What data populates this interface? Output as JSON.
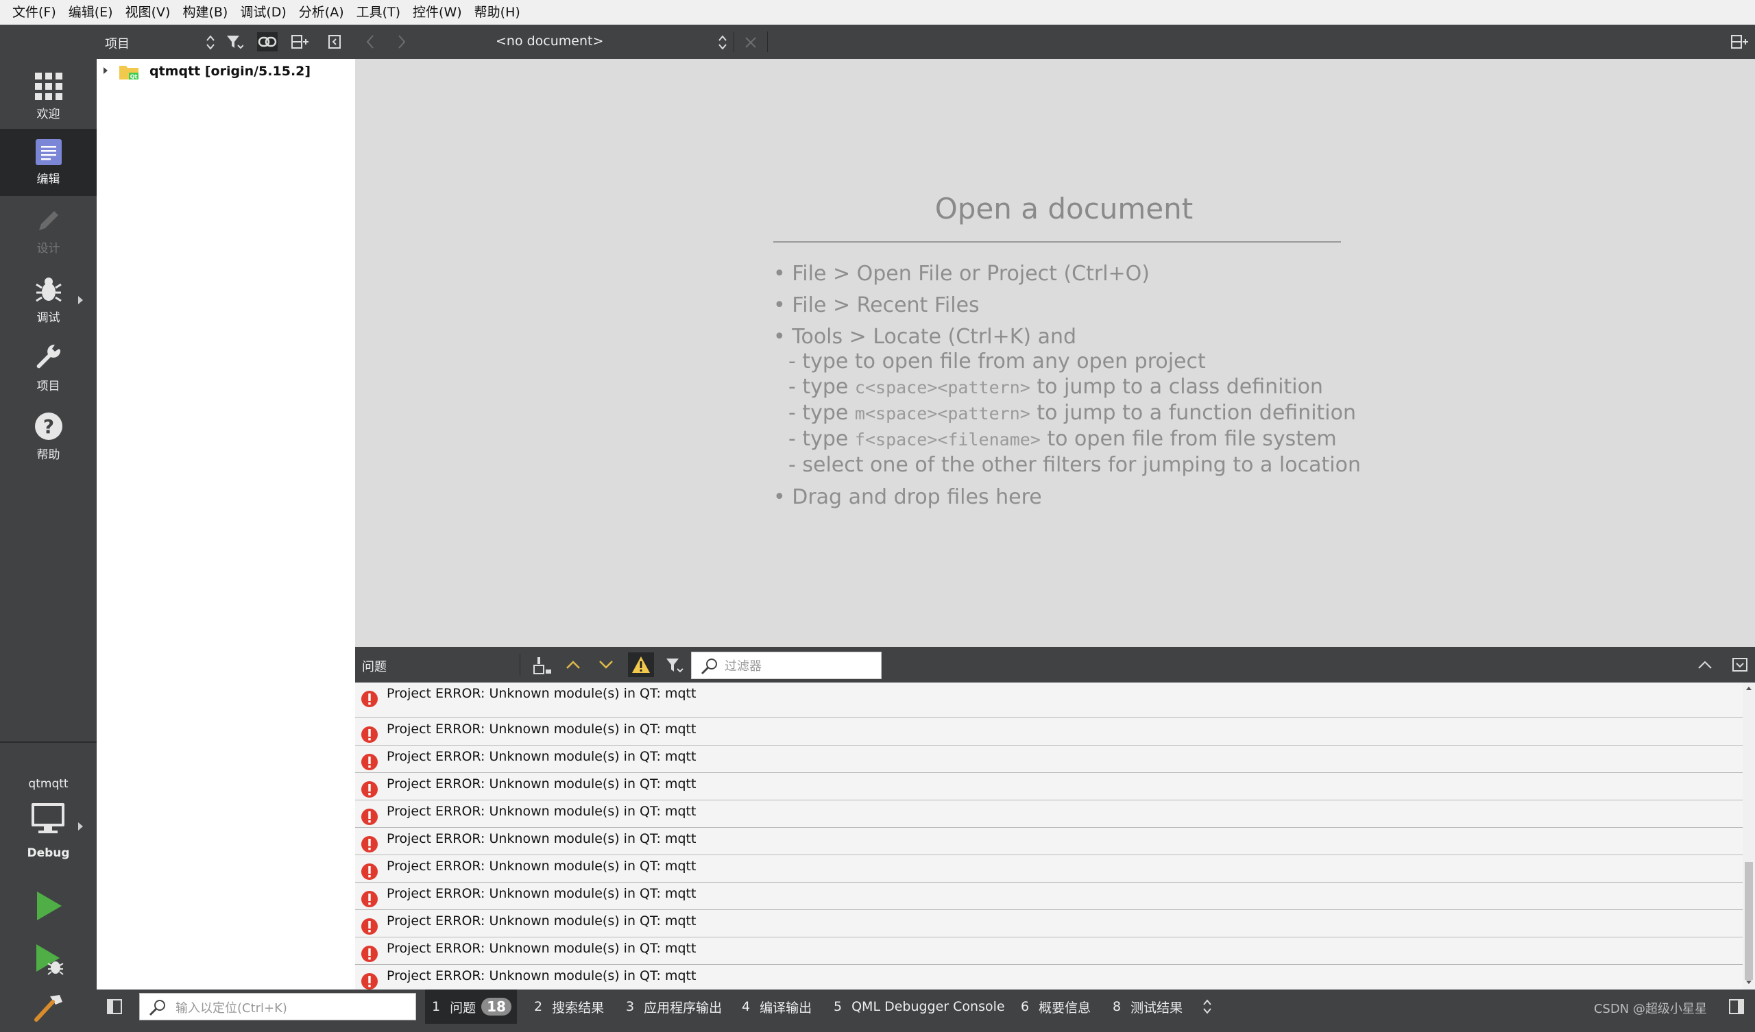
{
  "menu": [
    "文件(F)",
    "编辑(E)",
    "视图(V)",
    "构建(B)",
    "调试(D)",
    "分析(A)",
    "工具(T)",
    "控件(W)",
    "帮助(H)"
  ],
  "modes": [
    {
      "label": "欢迎",
      "icon": "grid-icon",
      "state": "normal"
    },
    {
      "label": "编辑",
      "icon": "edit-document-icon",
      "state": "active"
    },
    {
      "label": "设计",
      "icon": "pencil-icon",
      "state": "disabled"
    },
    {
      "label": "调试",
      "icon": "bug-icon",
      "state": "normal"
    },
    {
      "label": "项目",
      "icon": "wrench-icon",
      "state": "normal"
    },
    {
      "label": "帮助",
      "icon": "help-icon",
      "state": "normal"
    }
  ],
  "kit": {
    "project": "qtmqtt",
    "build": "Debug"
  },
  "project_panel": {
    "title": "项目",
    "tree": [
      {
        "label": "qtmqtt [origin/5.15.2]",
        "icon": "qt-folder-icon",
        "expanded": false
      }
    ]
  },
  "editor_toolbar": {
    "document": "<no document>"
  },
  "editor": {
    "title": "Open a document",
    "lines": [
      "• File > Open File or Project (Ctrl+O)",
      "• File > Recent Files",
      "• Tools > Locate (Ctrl+K) and"
    ],
    "sub": [
      {
        "pre": "- type ",
        "code": "",
        "post": "to open file from any open project"
      },
      {
        "pre": "- type ",
        "code": "c<space><pattern>",
        "post": " to jump to a class definition"
      },
      {
        "pre": "- type ",
        "code": "m<space><pattern>",
        "post": " to jump to a function definition"
      },
      {
        "pre": "- type ",
        "code": "f<space><filename>",
        "post": " to open file from file system"
      },
      {
        "pre": "- select one of the other filters for jumping to a location",
        "code": "",
        "post": ""
      }
    ],
    "last": "• Drag and drop files here"
  },
  "issues": {
    "title": "问题",
    "filter_placeholder": "过滤器",
    "rows": [
      "Project ERROR: Unknown module(s) in QT: mqtt",
      "Project ERROR: Unknown module(s) in QT: mqtt",
      "Project ERROR: Unknown module(s) in QT: mqtt",
      "Project ERROR: Unknown module(s) in QT: mqtt",
      "Project ERROR: Unknown module(s) in QT: mqtt",
      "Project ERROR: Unknown module(s) in QT: mqtt",
      "Project ERROR: Unknown module(s) in QT: mqtt",
      "Project ERROR: Unknown module(s) in QT: mqtt",
      "Project ERROR: Unknown module(s) in QT: mqtt",
      "Project ERROR: Unknown module(s) in QT: mqtt",
      "Project ERROR: Unknown module(s) in QT: mqtt"
    ]
  },
  "statusbar": {
    "locator_placeholder": "输入以定位(Ctrl+K)",
    "panes": [
      {
        "num": "1",
        "label": "问题",
        "badge": "18"
      },
      {
        "num": "2",
        "label": "搜索结果"
      },
      {
        "num": "3",
        "label": "应用程序输出"
      },
      {
        "num": "4",
        "label": "编译输出"
      },
      {
        "num": "5",
        "label": "QML Debugger Console"
      },
      {
        "num": "6",
        "label": "概要信息"
      },
      {
        "num": "8",
        "label": "测试结果"
      }
    ],
    "watermark": "CSDN @超级小星星"
  }
}
